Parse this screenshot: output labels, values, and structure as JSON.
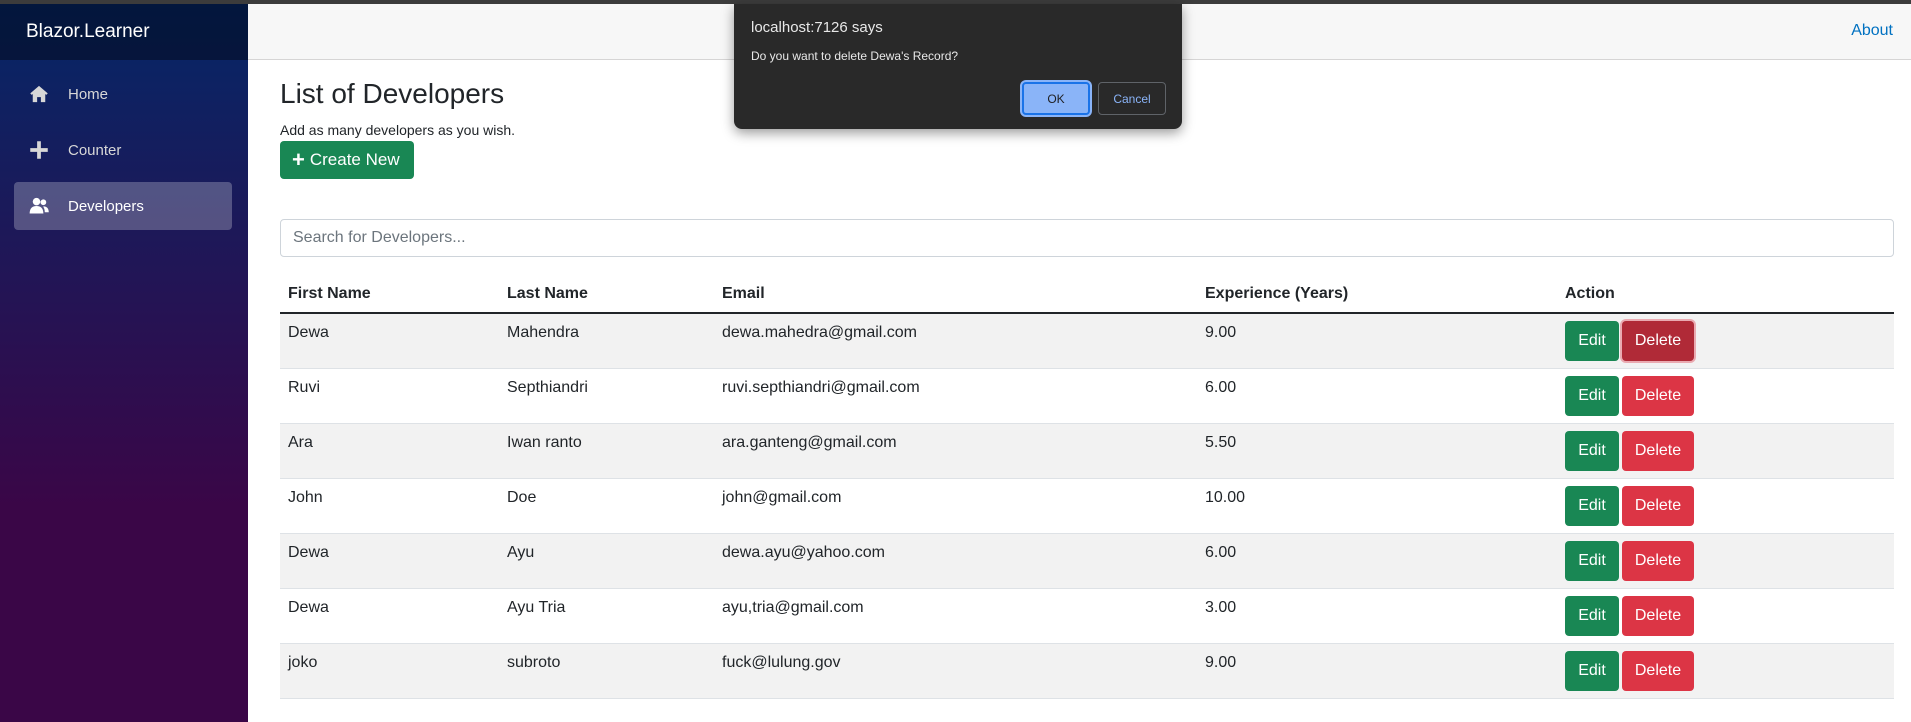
{
  "brand": "Blazor.Learner",
  "nav": [
    {
      "label": "Home",
      "icon": "home-icon"
    },
    {
      "label": "Counter",
      "icon": "plus-icon"
    },
    {
      "label": "Developers",
      "icon": "people-icon"
    }
  ],
  "top_row": {
    "about": "About"
  },
  "page": {
    "title": "List of Developers",
    "subtitle": "Add as many developers as you wish.",
    "create_label": "Create New",
    "search_placeholder": "Search for Developers..."
  },
  "table": {
    "headers": [
      "First Name",
      "Last Name",
      "Email",
      "Experience (Years)",
      "Action"
    ],
    "edit_label": "Edit",
    "delete_label": "Delete",
    "rows": [
      {
        "first": "Dewa",
        "last": "Mahendra",
        "email": "dewa.mahedra@gmail.com",
        "experience": "9.00"
      },
      {
        "first": "Ruvi",
        "last": "Septhiandri",
        "email": "ruvi.septhiandri@gmail.com",
        "experience": "6.00"
      },
      {
        "first": "Ara",
        "last": "Iwan ranto",
        "email": "ara.ganteng@gmail.com",
        "experience": "5.50"
      },
      {
        "first": "John",
        "last": "Doe",
        "email": "john@gmail.com",
        "experience": "10.00"
      },
      {
        "first": "Dewa",
        "last": "Ayu",
        "email": "dewa.ayu@yahoo.com",
        "experience": "6.00"
      },
      {
        "first": "Dewa",
        "last": "Ayu Tria",
        "email": "ayu,tria@gmail.com",
        "experience": "3.00"
      },
      {
        "first": "joko",
        "last": "subroto",
        "email": "fuck@lulung.gov",
        "experience": "9.00"
      }
    ]
  },
  "dialog": {
    "origin": "localhost:7126 says",
    "message": "Do you want to delete Dewa's Record?",
    "ok_label": "OK",
    "cancel_label": "Cancel"
  },
  "colors": {
    "success": "#198754",
    "danger": "#dc3545",
    "link": "#0071c1",
    "sidebar_top": "#052767",
    "sidebar_bottom": "#3a0647"
  }
}
